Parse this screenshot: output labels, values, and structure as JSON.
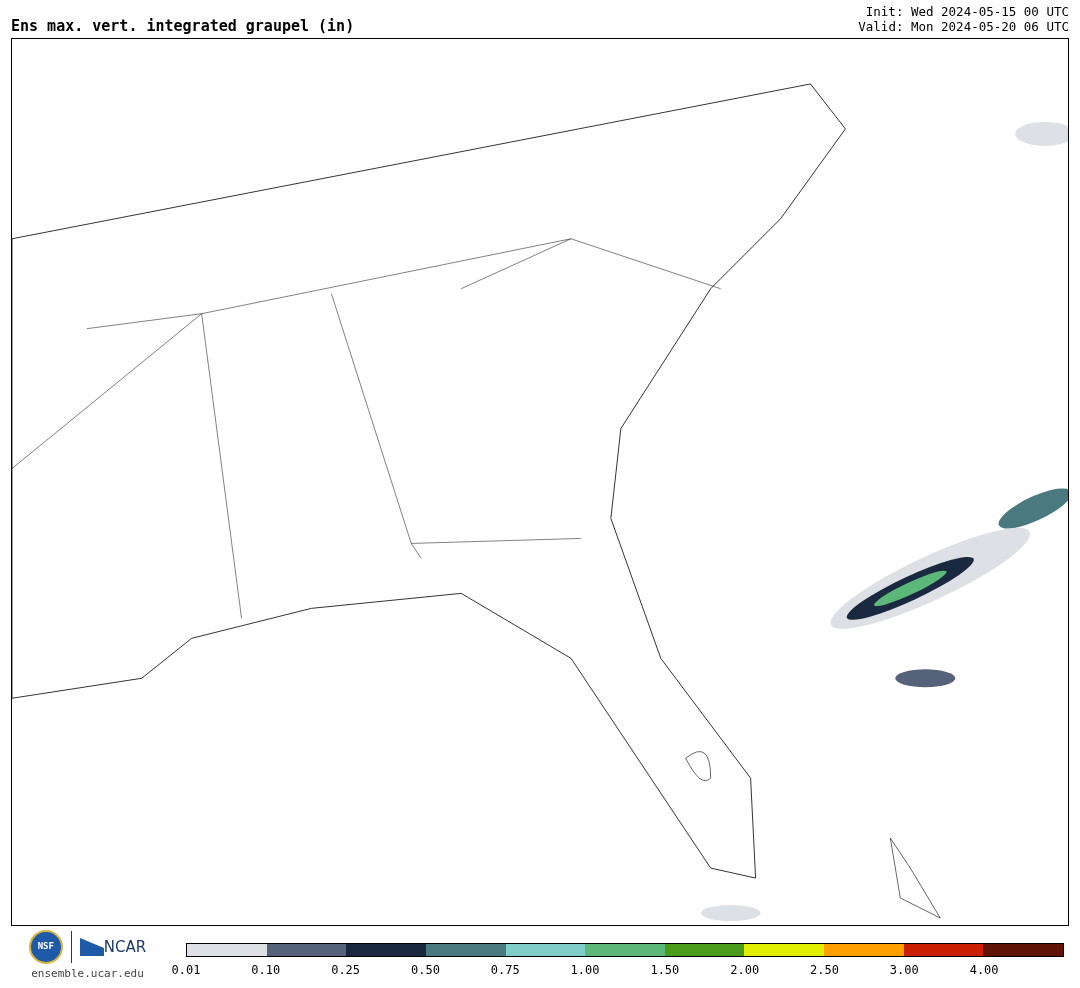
{
  "title": "Ens max. vert. integrated graupel (in)",
  "init": "Init: Wed 2024-05-15 00 UTC",
  "valid": "Valid: Mon 2024-05-20 06 UTC",
  "logos": {
    "nsf": "NSF",
    "ncar": "NCAR",
    "website": "ensemble.ucar.edu"
  },
  "colorbar": [
    {
      "label": "0.01",
      "color": "#dde1e6"
    },
    {
      "label": "0.10",
      "color": "#56627a"
    },
    {
      "label": "0.25",
      "color": "#1b2940"
    },
    {
      "label": "0.50",
      "color": "#4a7a80"
    },
    {
      "label": "0.75",
      "color": "#7ecdc8"
    },
    {
      "label": "1.00",
      "color": "#5bb878"
    },
    {
      "label": "1.50",
      "color": "#4a9a1c"
    },
    {
      "label": "2.00",
      "color": "#e0ee00"
    },
    {
      "label": "2.50",
      "color": "#ffa000"
    },
    {
      "label": "3.00",
      "color": "#c82000"
    },
    {
      "label": "4.00",
      "color": "#601408"
    }
  ]
}
